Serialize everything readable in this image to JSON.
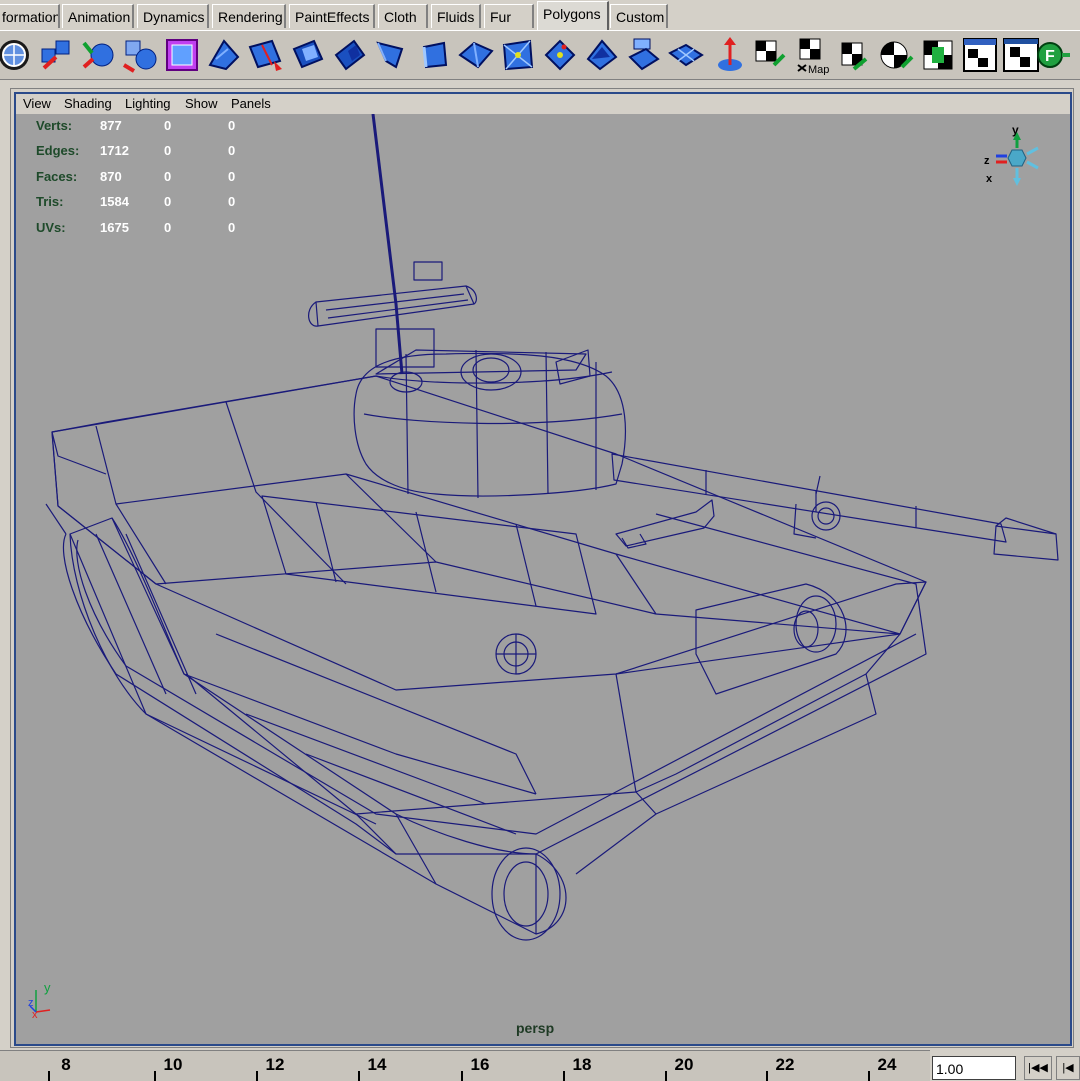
{
  "shelf": {
    "tabs": [
      "formation",
      "Animation",
      "Dynamics",
      "Rendering",
      "PaintEffects",
      "Cloth",
      "Fluids",
      "Fur",
      "Polygons",
      "Custom"
    ],
    "active_tab": "Polygons",
    "overlay_text": "Map"
  },
  "panel_menu": [
    "View",
    "Shading",
    "Lighting",
    "Show",
    "Panels"
  ],
  "hud": {
    "rows": [
      {
        "label": "Verts:",
        "values": [
          "877",
          "0",
          "0"
        ]
      },
      {
        "label": "Edges:",
        "values": [
          "1712",
          "0",
          "0"
        ]
      },
      {
        "label": "Faces:",
        "values": [
          "870",
          "0",
          "0"
        ]
      },
      {
        "label": "Tris:",
        "values": [
          "1584",
          "0",
          "0"
        ]
      },
      {
        "label": "UVs:",
        "values": [
          "1675",
          "0",
          "0"
        ]
      }
    ]
  },
  "view_cube": {
    "axes": [
      "y",
      "z",
      "x"
    ]
  },
  "origin_axes": [
    "y",
    "z",
    "x"
  ],
  "camera_label": "persp",
  "timeline": {
    "ticks": [
      "8",
      "10",
      "12",
      "14",
      "16",
      "18",
      "20",
      "22",
      "24"
    ],
    "current_frame": "1.00"
  },
  "colors": {
    "wireframe": "#1a1a7a",
    "viewport_bg": "#a0a0a0",
    "panel_border": "#2a4a8a",
    "ui_bg": "#d4d0c8"
  }
}
